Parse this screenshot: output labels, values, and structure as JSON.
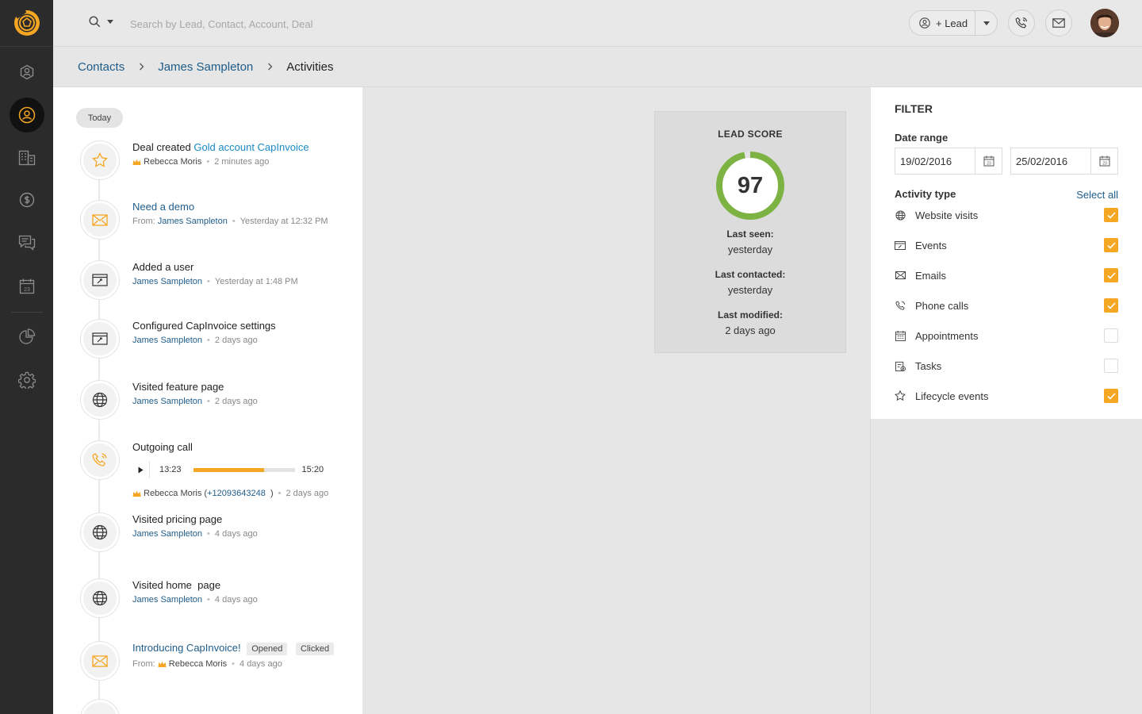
{
  "search": {
    "placeholder": "Search by Lead, Contact, Account, Deal"
  },
  "topbar": {
    "lead_button": "+ Lead"
  },
  "breadcrumb": {
    "items": [
      "Contacts",
      "James Sampleton",
      "Activities"
    ]
  },
  "activities": {
    "today_label": "Today",
    "items": [
      {
        "prefix": "Deal created ",
        "title_link": "Gold account CapInvoice",
        "owner": "Rebecca Moris",
        "time": "2 minutes ago"
      },
      {
        "title_link": "Need a demo",
        "from_label": "From:",
        "who": "James Sampleton",
        "time": "Yesterday at 12:32 PM"
      },
      {
        "title": "Added a user",
        "who": "James Sampleton",
        "time": "Yesterday at 1:48 PM"
      },
      {
        "title": "Configured CapInvoice settings",
        "who": "James Sampleton",
        "time": "2 days ago"
      },
      {
        "title": "Visited feature page",
        "who": "James Sampleton",
        "time": "2 days ago"
      },
      {
        "title": "Outgoing call",
        "player_start": "13:23",
        "player_end": "15:20",
        "player_progress": 0.7,
        "owner": "Rebecca Moris",
        "paren_open": "(",
        "phone": "+12093643248",
        "paren_close": ")",
        "time": "2 days ago"
      },
      {
        "title": "Visited pricing page",
        "who": "James Sampleton",
        "time": "4 days ago"
      },
      {
        "title": "Visited home  page",
        "who": "James Sampleton",
        "time": "4 days ago"
      },
      {
        "title_link": "Introducing CapInvoice!",
        "tag1": "Opened",
        "tag2": "Clicked",
        "from_label": "From:",
        "owner": "Rebecca Moris",
        "time": "4 days ago"
      }
    ]
  },
  "lead_score": {
    "title": "LEAD SCORE",
    "score": "97",
    "score_fraction": 0.97,
    "last_seen_label": "Last seen:",
    "last_seen": "yesterday",
    "last_contacted_label": "Last contacted:",
    "last_contacted": "yesterday",
    "last_modified_label": "Last modified:",
    "last_modified": "2 days ago"
  },
  "filter": {
    "title": "FILTER",
    "date_range_label": "Date range",
    "date_from": "19/02/2016",
    "date_to": "25/02/2016",
    "activity_type_label": "Activity type",
    "select_all": "Select all",
    "types": [
      {
        "label": "Website visits",
        "checked": true
      },
      {
        "label": "Events",
        "checked": true
      },
      {
        "label": "Emails",
        "checked": true
      },
      {
        "label": "Phone calls",
        "checked": true
      },
      {
        "label": "Appointments",
        "checked": false
      },
      {
        "label": "Tasks",
        "checked": false
      },
      {
        "label": "Lifecycle events",
        "checked": true
      }
    ]
  },
  "colors": {
    "accent": "#f5a623",
    "link": "#1e5c8a",
    "link_bright": "#1a8ac4",
    "score_ring": "#7cb342",
    "sidebar": "#2b2b2b"
  }
}
